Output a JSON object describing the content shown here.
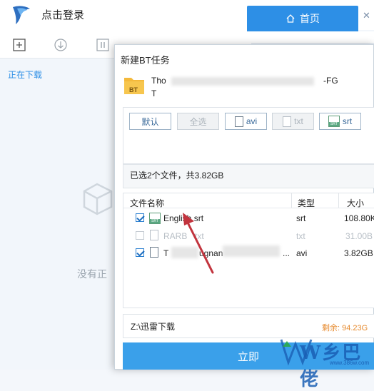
{
  "app": {
    "login_label": "点击登录",
    "home_tab_label": "首页",
    "sidebar_downloading": "正在下载",
    "empty_text": "没有正"
  },
  "dialog": {
    "title": "新建BT任务",
    "torrent_icon_label": "BT",
    "torrent_name_line1": "Tho",
    "torrent_name_suffix": "-FG",
    "torrent_name_line2": "T",
    "filters": [
      {
        "label": "默认",
        "enabled": true
      },
      {
        "label": "全选",
        "enabled": false
      },
      {
        "label": "avi",
        "enabled": true,
        "icon": "document-icon"
      },
      {
        "label": "txt",
        "enabled": false,
        "icon": "document-icon"
      },
      {
        "label": "srt",
        "enabled": true,
        "icon": "srt-file-icon"
      }
    ],
    "selected_summary": "已选2个文件，共3.82GB",
    "columns": [
      "文件名称",
      "类型",
      "大小"
    ],
    "files": [
      {
        "name": "English.srt",
        "type": "srt",
        "size": "108.80K",
        "checked": true,
        "enabled": true,
        "icon": "srt-file-icon"
      },
      {
        "name": "RARB",
        "name_tail": "txt",
        "type": "txt",
        "size": "31.00B",
        "checked": false,
        "enabled": false,
        "icon": "document-icon"
      },
      {
        "name": "T",
        "name_tail": "ugnan",
        "name_end": "...",
        "type": "avi",
        "size": "3.82GB",
        "checked": true,
        "enabled": true,
        "icon": "document-icon"
      }
    ],
    "save_path": "Z:\\迅雷下载",
    "free_space": "剩余: 94.23G",
    "start_button": "立即"
  },
  "watermark": {
    "text": "W乡巴佬",
    "url": "www.386w.com"
  },
  "colors": {
    "accent": "#2d8fe6",
    "start_button": "#3aa0ea",
    "free_space": "#e68a2e",
    "arrow": "#c2343e"
  }
}
